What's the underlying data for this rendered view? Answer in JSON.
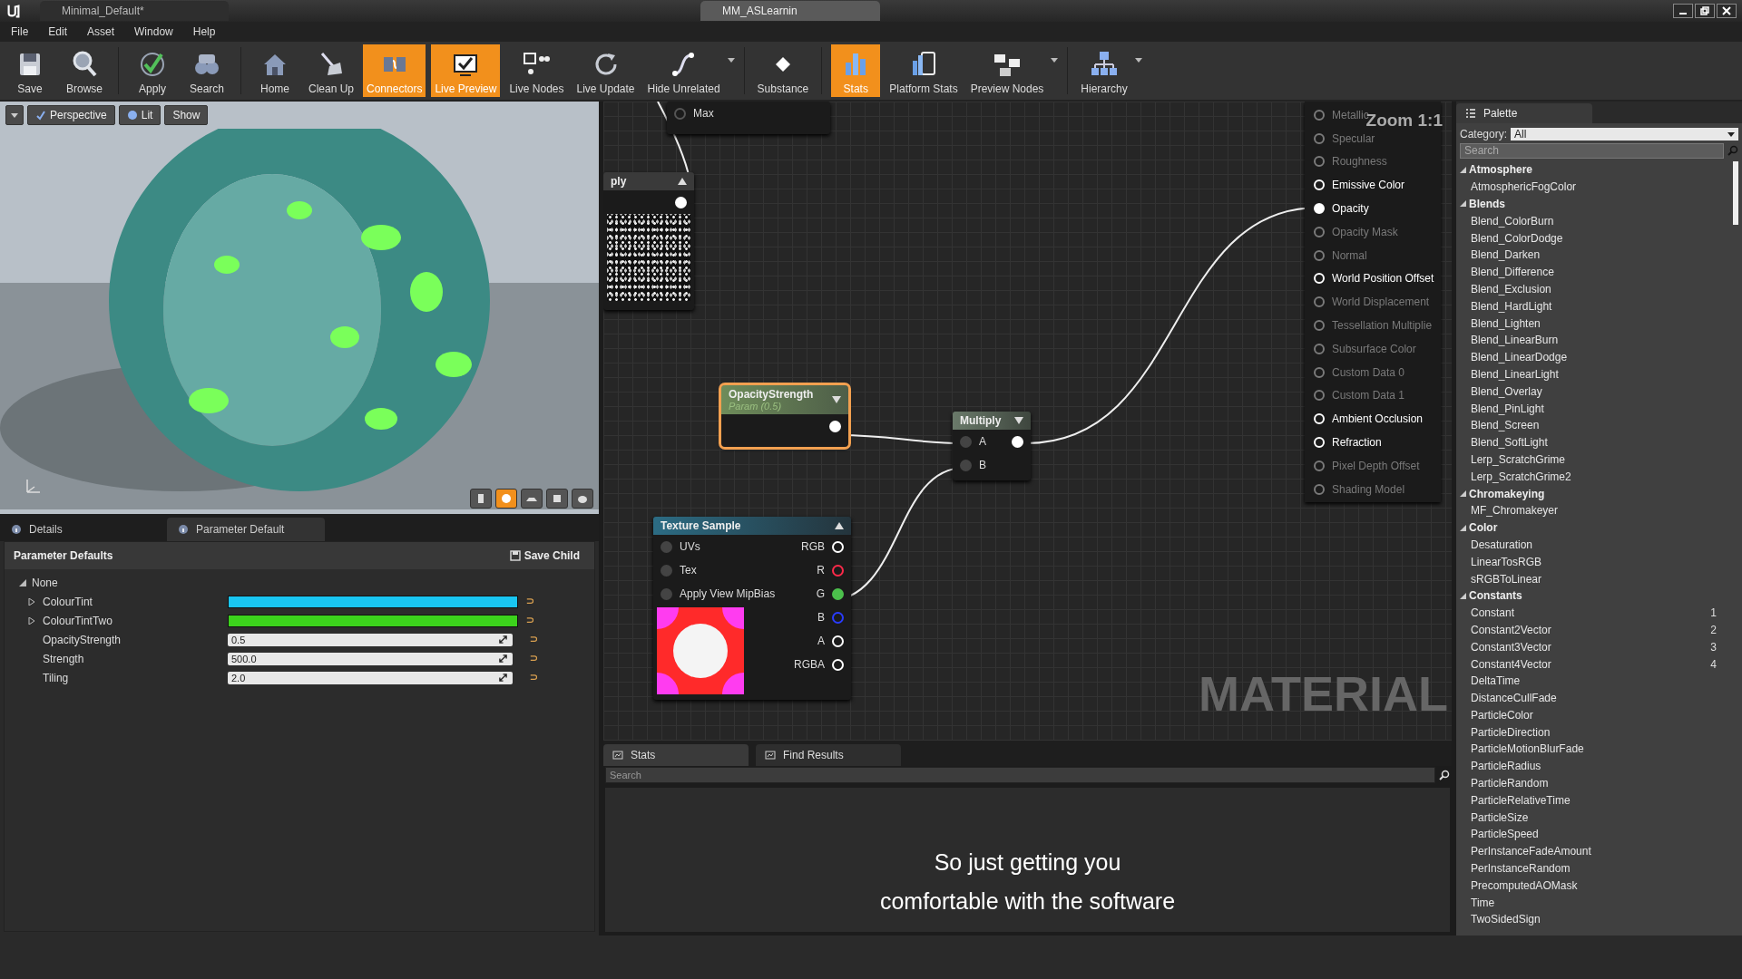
{
  "window": {
    "tabs": [
      {
        "label": "Minimal_Default*",
        "selected": false
      },
      {
        "label": "MM_ASLearnin",
        "selected": true
      }
    ]
  },
  "menu": [
    "File",
    "Edit",
    "Asset",
    "Window",
    "Help"
  ],
  "toolbar": {
    "groups": [
      [
        {
          "label": "Save",
          "active": false,
          "has_menu": false
        },
        {
          "label": "Browse",
          "active": false,
          "has_menu": false
        }
      ],
      [
        {
          "label": "Apply",
          "active": false,
          "has_menu": false
        },
        {
          "label": "Search",
          "active": false,
          "has_menu": false
        }
      ],
      [
        {
          "label": "Home",
          "active": false,
          "has_menu": false
        },
        {
          "label": "Clean Up",
          "active": false,
          "has_menu": false
        },
        {
          "label": "Connectors",
          "active": true,
          "has_menu": false
        },
        {
          "label": "Live Preview",
          "active": true,
          "has_menu": false
        },
        {
          "label": "Live Nodes",
          "active": false,
          "has_menu": false
        },
        {
          "label": "Live Update",
          "active": false,
          "has_menu": false
        },
        {
          "label": "Hide Unrelated",
          "active": false,
          "has_menu": true
        }
      ],
      [
        {
          "label": "Substance",
          "active": false,
          "has_menu": false
        }
      ],
      [
        {
          "label": "Stats",
          "active": true,
          "has_menu": false
        },
        {
          "label": "Platform Stats",
          "active": false,
          "has_menu": false
        },
        {
          "label": "Preview Nodes",
          "active": false,
          "has_menu": true
        }
      ],
      [
        {
          "label": "Hierarchy",
          "active": false,
          "has_menu": true
        }
      ]
    ]
  },
  "viewport": {
    "buttons": [
      {
        "label": "Perspective"
      },
      {
        "label": "Lit"
      },
      {
        "label": "Show"
      }
    ],
    "preview_shapes": [
      {
        "selected": false
      },
      {
        "selected": true
      },
      {
        "selected": false
      },
      {
        "selected": false
      },
      {
        "selected": false
      }
    ]
  },
  "details": {
    "tabs": [
      {
        "label": "Details",
        "selected": false
      },
      {
        "label": "Parameter Default",
        "selected": true
      }
    ],
    "title": "Parameter Defaults",
    "save_button": "Save Child",
    "group": {
      "label": "None",
      "expanded": true,
      "children": [
        {
          "name": "ColourTint",
          "kind": "color",
          "expanded": false,
          "color": "#19c6f2"
        },
        {
          "name": "ColourTintTwo",
          "kind": "color",
          "expanded": false,
          "color": "#3cd21c"
        },
        {
          "name": "OpacityStrength",
          "kind": "number",
          "value": "0.5"
        },
        {
          "name": "Strength",
          "kind": "number",
          "value": "500.0"
        },
        {
          "name": "Tiling",
          "kind": "number",
          "value": "2.0"
        }
      ]
    }
  },
  "graph": {
    "zoom_label": "Zoom 1:1",
    "watermark_label": "MATERIAL",
    "nodes": [
      {
        "kind": "clipped",
        "label": "Max",
        "selected": false
      },
      {
        "kind": "clipped-texture",
        "title": "ply",
        "selected": false
      },
      {
        "kind": "parameter",
        "title": "OpacityStrength",
        "subtitle": "Param (0.5)",
        "selected": true
      },
      {
        "kind": "math",
        "title": "Multiply",
        "inputs": [
          "A",
          "B"
        ],
        "selected": false
      },
      {
        "kind": "texture",
        "title": "Texture Sample",
        "inputs": [
          "UVs",
          "Tex",
          "Apply View MipBias"
        ],
        "selected": false,
        "outputs": [
          {
            "label": "RGB",
            "color": "#ffffff",
            "connected": false
          },
          {
            "label": "R",
            "color": "#ff2a4a",
            "connected": false
          },
          {
            "label": "G",
            "color": "#4cc04c",
            "connected": true
          },
          {
            "label": "B",
            "color": "#2a3cff",
            "connected": false
          },
          {
            "label": "A",
            "color": "#ffffff",
            "connected": false
          },
          {
            "label": "RGBA",
            "color": "#ffffff",
            "connected": false
          }
        ]
      }
    ],
    "material_pins": [
      {
        "label": "Metallic",
        "enabled": false,
        "connected": false
      },
      {
        "label": "Specular",
        "enabled": false,
        "connected": false
      },
      {
        "label": "Roughness",
        "enabled": false,
        "connected": false
      },
      {
        "label": "Emissive Color",
        "enabled": true,
        "connected": false
      },
      {
        "label": "Opacity",
        "enabled": true,
        "connected": true
      },
      {
        "label": "Opacity Mask",
        "enabled": false,
        "connected": false
      },
      {
        "label": "Normal",
        "enabled": false,
        "connected": false
      },
      {
        "label": "World Position Offset",
        "enabled": true,
        "connected": false
      },
      {
        "label": "World Displacement",
        "enabled": false,
        "connected": false
      },
      {
        "label": "Tessellation Multiplie",
        "enabled": false,
        "connected": false
      },
      {
        "label": "Subsurface Color",
        "enabled": false,
        "connected": false
      },
      {
        "label": "Custom Data 0",
        "enabled": false,
        "connected": false
      },
      {
        "label": "Custom Data 1",
        "enabled": false,
        "connected": false
      },
      {
        "label": "Ambient Occlusion",
        "enabled": true,
        "connected": false
      },
      {
        "label": "Refraction",
        "enabled": true,
        "connected": false
      },
      {
        "label": "Pixel Depth Offset",
        "enabled": false,
        "connected": false
      },
      {
        "label": "Shading Model",
        "enabled": false,
        "connected": false
      }
    ]
  },
  "results": {
    "tabs": [
      {
        "label": "Stats",
        "selected": true
      },
      {
        "label": "Find Results",
        "selected": false
      }
    ],
    "search_placeholder": "Search",
    "caption_lines": [
      "So just getting you",
      "comfortable with the software"
    ]
  },
  "palette": {
    "title": "Palette",
    "category_label": "Category:",
    "category_value": "All",
    "search_placeholder": "Search",
    "groups": [
      {
        "name": "Atmosphere",
        "expanded": true,
        "children": [
          {
            "name": "AtmosphericFogColor"
          }
        ]
      },
      {
        "name": "Blends",
        "expanded": true,
        "children": [
          {
            "name": "Blend_ColorBurn"
          },
          {
            "name": "Blend_ColorDodge"
          },
          {
            "name": "Blend_Darken"
          },
          {
            "name": "Blend_Difference"
          },
          {
            "name": "Blend_Exclusion"
          },
          {
            "name": "Blend_HardLight"
          },
          {
            "name": "Blend_Lighten"
          },
          {
            "name": "Blend_LinearBurn"
          },
          {
            "name": "Blend_LinearDodge"
          },
          {
            "name": "Blend_LinearLight"
          },
          {
            "name": "Blend_Overlay"
          },
          {
            "name": "Blend_PinLight"
          },
          {
            "name": "Blend_Screen"
          },
          {
            "name": "Blend_SoftLight"
          },
          {
            "name": "Lerp_ScratchGrime"
          },
          {
            "name": "Lerp_ScratchGrime2"
          }
        ]
      },
      {
        "name": "Chromakeying",
        "expanded": true,
        "children": [
          {
            "name": "MF_Chromakeyer"
          }
        ]
      },
      {
        "name": "Color",
        "expanded": true,
        "children": [
          {
            "name": "Desaturation"
          },
          {
            "name": "LinearTosRGB"
          },
          {
            "name": "sRGBToLinear"
          }
        ]
      },
      {
        "name": "Constants",
        "expanded": true,
        "children": [
          {
            "name": "Constant",
            "shortcut": "1"
          },
          {
            "name": "Constant2Vector",
            "shortcut": "2"
          },
          {
            "name": "Constant3Vector",
            "shortcut": "3"
          },
          {
            "name": "Constant4Vector",
            "shortcut": "4"
          },
          {
            "name": "DeltaTime"
          },
          {
            "name": "DistanceCullFade"
          },
          {
            "name": "ParticleColor"
          },
          {
            "name": "ParticleDirection"
          },
          {
            "name": "ParticleMotionBlurFade"
          },
          {
            "name": "ParticleRadius"
          },
          {
            "name": "ParticleRandom"
          },
          {
            "name": "ParticleRelativeTime"
          },
          {
            "name": "ParticleSize"
          },
          {
            "name": "ParticleSpeed"
          },
          {
            "name": "PerInstanceFadeAmount"
          },
          {
            "name": "PerInstanceRandom"
          },
          {
            "name": "PrecomputedAOMask"
          },
          {
            "name": "Time"
          },
          {
            "name": "TwoSidedSign"
          }
        ]
      }
    ]
  }
}
